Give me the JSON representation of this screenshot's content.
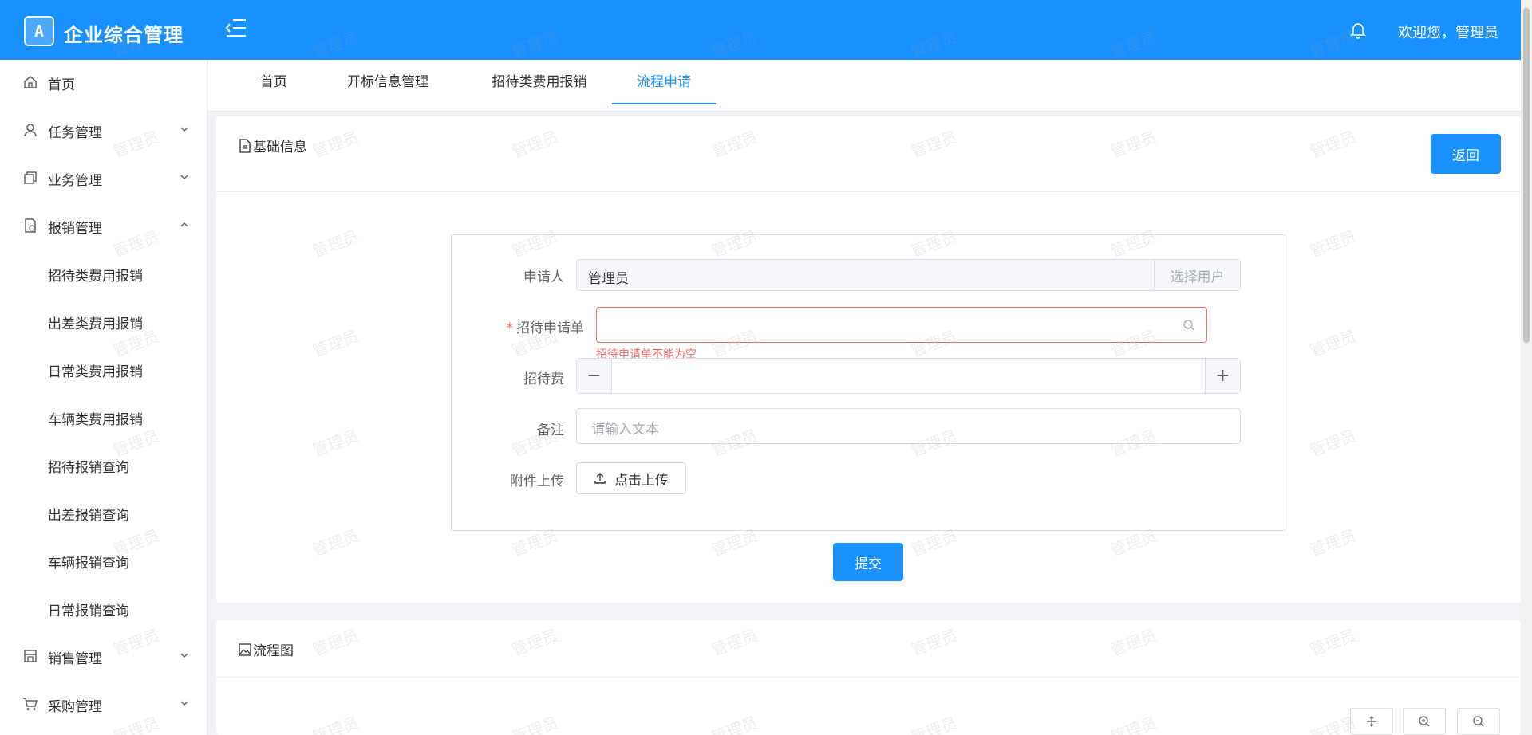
{
  "header": {
    "logo_text": "A",
    "app_title": "企业综合管理",
    "welcome": "欢迎您，管理员"
  },
  "sidebar": {
    "items": [
      {
        "label": "首页",
        "icon": "home-icon"
      },
      {
        "label": "任务管理",
        "icon": "user-icon"
      },
      {
        "label": "业务管理",
        "icon": "copy-icon"
      },
      {
        "label": "报销管理",
        "icon": "document-icon"
      },
      {
        "label": "销售管理",
        "icon": "shop-icon"
      },
      {
        "label": "采购管理",
        "icon": "cart-icon"
      }
    ],
    "submenu": [
      {
        "label": "招待类费用报销"
      },
      {
        "label": "出差类费用报销"
      },
      {
        "label": "日常类费用报销"
      },
      {
        "label": "车辆类费用报销"
      },
      {
        "label": "招待报销查询"
      },
      {
        "label": "出差报销查询"
      },
      {
        "label": "车辆报销查询"
      },
      {
        "label": "日常报销查询"
      }
    ]
  },
  "tabs": [
    {
      "label": "首页"
    },
    {
      "label": "开标信息管理"
    },
    {
      "label": "招待类费用报销"
    },
    {
      "label": "流程申请"
    }
  ],
  "basic_card": {
    "title": "基础信息",
    "back_label": "返回"
  },
  "form": {
    "applicant_label": "申请人",
    "applicant_value": "管理员",
    "select_user_label": "选择用户",
    "request_label": "招待申请单",
    "request_error": "招待申请单不能为空",
    "fee_label": "招待费",
    "note_label": "备注",
    "note_placeholder": "请输入文本",
    "upload_label": "附件上传",
    "upload_button": "点击上传",
    "submit_label": "提交"
  },
  "flow_card": {
    "title": "流程图"
  },
  "watermark": "管理员",
  "colors": {
    "primary": "#1890ff",
    "error": "#f56c6c",
    "border": "#dcdfe6"
  }
}
